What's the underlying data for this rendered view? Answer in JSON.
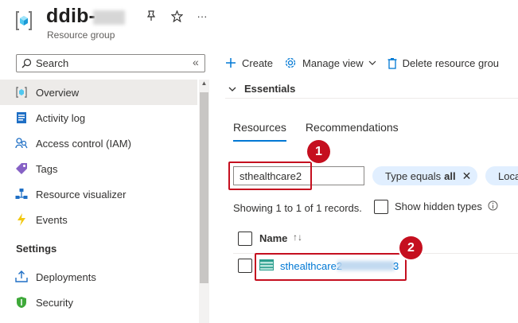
{
  "header": {
    "title": "ddib-",
    "subtitle": "Resource group",
    "pin_icon": "pin-icon",
    "star_icon": "star-icon",
    "more_label": "···"
  },
  "sidebar": {
    "search_placeholder": "Search",
    "collapse_label": "«",
    "items": [
      {
        "label": "Overview",
        "icon": "overview-icon"
      },
      {
        "label": "Activity log",
        "icon": "activity-log-icon"
      },
      {
        "label": "Access control (IAM)",
        "icon": "iam-icon"
      },
      {
        "label": "Tags",
        "icon": "tag-icon"
      },
      {
        "label": "Resource visualizer",
        "icon": "visualizer-icon"
      },
      {
        "label": "Events",
        "icon": "events-icon"
      }
    ],
    "section_settings": "Settings",
    "settings_items": [
      {
        "label": "Deployments",
        "icon": "deployments-icon"
      },
      {
        "label": "Security",
        "icon": "security-icon"
      }
    ]
  },
  "toolbar": {
    "create_label": "Create",
    "manage_view_label": "Manage view",
    "delete_label": "Delete resource grou"
  },
  "essentials": {
    "label": "Essentials"
  },
  "tabs": [
    {
      "label": "Resources",
      "active": true
    },
    {
      "label": "Recommendations",
      "active": false
    }
  ],
  "filter": {
    "value": "sthealthcare2",
    "type_pill_prefix": "Type equals",
    "type_pill_value": "all",
    "location_pill": "Loca"
  },
  "records_text": "Showing 1 to 1 of 1 records.",
  "show_hidden_label": "Show hidden types",
  "table": {
    "name_header": "Name",
    "rows": [
      {
        "name_prefix": "sthealthcare2",
        "name_suffix": "3"
      }
    ]
  },
  "callouts": [
    "1",
    "2"
  ],
  "colors": {
    "accent": "#0078d4",
    "callout": "#c50f1f",
    "active_nav": "#edebe9",
    "pill_bg": "#e1efff"
  }
}
